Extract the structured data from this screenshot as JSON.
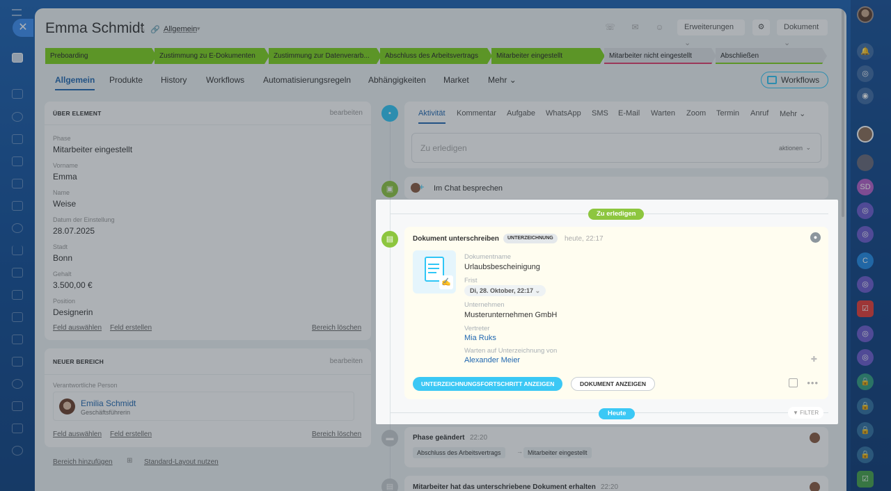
{
  "header": {
    "title": "Emma Schmidt",
    "subtitle": "Allgemein",
    "erweiterungen": "Erweiterungen",
    "dokument": "Dokument"
  },
  "stages": [
    "Preboarding",
    "Zustimmung zu E-Dokumenten",
    "Zustimmung zur Datenverarb...",
    "Abschluss des Arbeitsvertrags",
    "Mitarbeiter eingestellt",
    "Mitarbeiter nicht eingestellt",
    "Abschließen"
  ],
  "stage_colors": {
    "done": "#7dd21b",
    "pending": "#dfe3e5",
    "failed_line": "#e33b6b",
    "close_line": "#7dd21b"
  },
  "tabs": [
    "Allgemein",
    "Produkte",
    "History",
    "Workflows",
    "Automatisierungsregeln",
    "Abhängigkeiten",
    "Market",
    "Mehr"
  ],
  "workflows_button": "Workflows",
  "about": {
    "heading": "ÜBER ELEMENT",
    "edit": "bearbeiten",
    "fields": [
      {
        "label": "Phase",
        "value": "Mitarbeiter eingestellt"
      },
      {
        "label": "Vorname",
        "value": "Emma"
      },
      {
        "label": "Name",
        "value": "Weise"
      },
      {
        "label": "Datum der Einstellung",
        "value": "28.07.2025"
      },
      {
        "label": "Stadt",
        "value": "Bonn"
      },
      {
        "label": "Gehalt",
        "value": "3.500,00 €"
      },
      {
        "label": "Position",
        "value": "Designerin"
      }
    ],
    "select_field": "Feld auswählen",
    "create_field": "Feld erstellen",
    "delete_section": "Bereich löschen"
  },
  "new_section": {
    "heading": "NEUER BEREICH",
    "edit": "bearbeiten",
    "label": "Verantwortliche Person",
    "person_name": "Emilia Schmidt",
    "person_role": "Geschäftsführerin",
    "select_field": "Feld auswählen",
    "create_field": "Feld erstellen",
    "delete_section": "Bereich löschen"
  },
  "bottom": {
    "add_section": "Bereich hinzufügen",
    "standard_layout": "Standard-Layout nutzen"
  },
  "activity": {
    "tabs": [
      "Aktivität",
      "Kommentar",
      "Aufgabe",
      "WhatsApp",
      "SMS",
      "E-Mail",
      "Warten",
      "Zoom",
      "Termin",
      "Anruf",
      "Mehr"
    ],
    "placeholder": "Zu erledigen",
    "actions": "aktionen"
  },
  "chat": {
    "label": "Im Chat besprechen"
  },
  "todo_badge": "Zu erledigen",
  "doc_card": {
    "title": "Dokument unterschreiben",
    "badge": "UNTERZEICHNUNG",
    "time": "heute, 22:17",
    "doc_name_label": "Dokumentname",
    "doc_name": "Urlaubsbescheinigung",
    "deadline_label": "Frist",
    "deadline": "Di, 28. Oktober, 22:17",
    "company_label": "Unternehmen",
    "company": "Musterunternehmen GmbH",
    "rep_label": "Vertreter",
    "rep": "Mia Ruks",
    "waiting_label": "Warten auf Unterzeichnung von",
    "waiting": "Alexander Meier",
    "progress_button": "UNTERZEICHNUNGSFORTSCHRITT ANZEIGEN",
    "show_button": "DOKUMENT ANZEIGEN"
  },
  "today_badge": "Heute",
  "filter": "FILTER",
  "history": [
    {
      "title": "Phase geändert",
      "time": "22:20",
      "from": "Abschluss des Arbeitsvertrags",
      "to": "Mitarbeiter eingestellt"
    },
    {
      "title": "Mitarbeiter hat das unterschriebene Dokument erhalten",
      "time": "22:20"
    }
  ],
  "colors": {
    "accent": "#2067b0",
    "green": "#8dc63f",
    "cyan": "#3bc8f5"
  }
}
